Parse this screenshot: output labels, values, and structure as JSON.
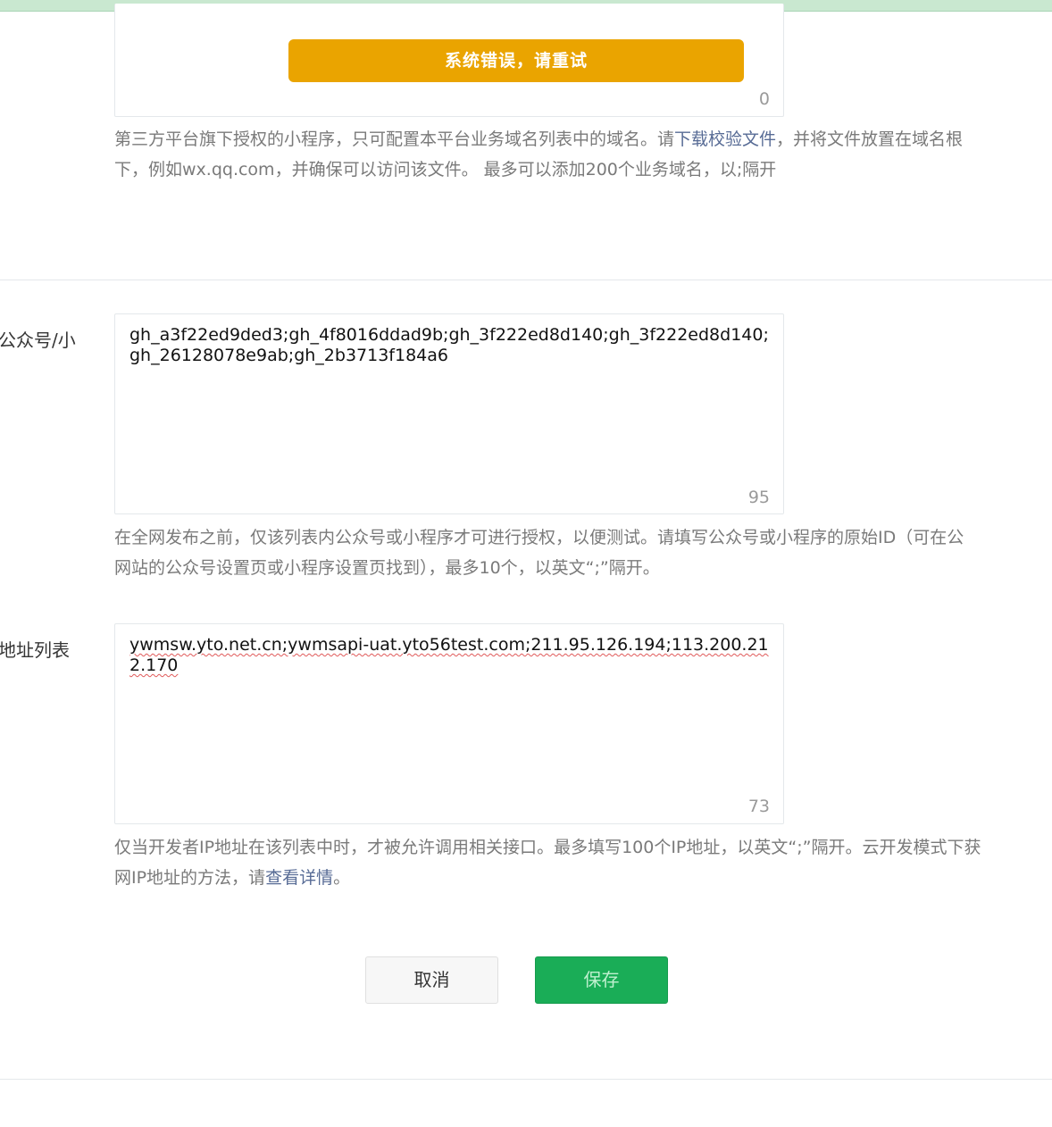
{
  "banner": {
    "error_text": "系统错误，请重试"
  },
  "domain_field": {
    "counter": "0",
    "hint_line1_prefix": "第三方平台旗下授权的小程序，只可配置本平台业务域名列表中的域名。请",
    "hint_link": "下载校验文件",
    "hint_line1_suffix": "，并将文件放置在域名根",
    "hint_line2": "下，例如wx.qq.com，并确保可以访问该文件。 最多可以添加200个业务域名，以;隔开"
  },
  "whitelist_field": {
    "label": "公众号/小",
    "value": "gh_a3f22ed9ded3;gh_4f8016ddad9b;gh_3f222ed8d140;gh_3f222ed8d140;gh_26128078e9ab;gh_2b3713f184a6",
    "counter": "95",
    "hint_line1": "在全网发布之前，仅该列表内公众号或小程序才可进行授权，以便测试。请填写公众号或小程序的原始ID（可在公",
    "hint_line2": "网站的公众号设置页或小程序设置页找到），最多10个，以英文“;”隔开。"
  },
  "ip_field": {
    "label": "地址列表",
    "value": "ywmsw.yto.net.cn;ywmsapi-uat.yto56test.com;211.95.126.194;113.200.212.170",
    "counter": "73",
    "hint_line1": "仅当开发者IP地址在该列表中时，才被允许调用相关接口。最多填写100个IP地址，以英文“;”隔开。云开发模式下获",
    "hint_line2_prefix": "网IP地址的方法，请",
    "hint_link": "查看详情",
    "hint_line2_suffix": "。"
  },
  "actions": {
    "cancel_label": "取消",
    "save_label": "保存"
  },
  "colors": {
    "error_banner": "#eaa400",
    "primary_button": "#1aad57",
    "link": "#576b95"
  }
}
